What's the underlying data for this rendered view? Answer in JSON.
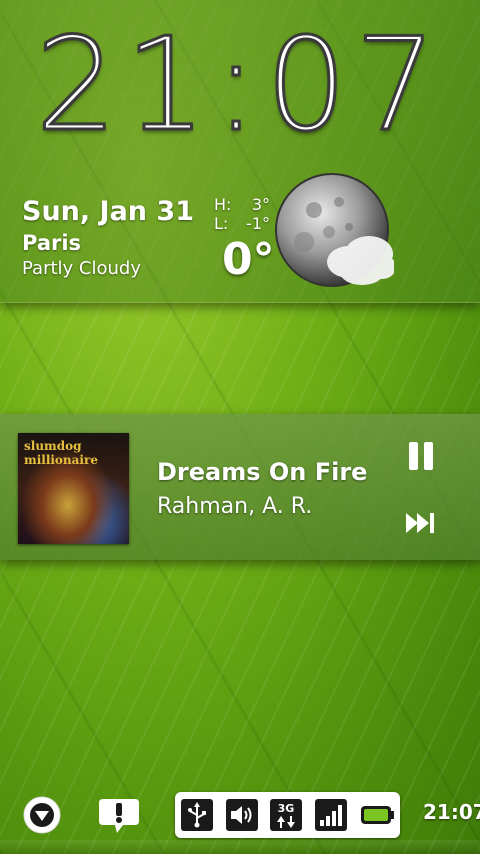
{
  "clock": {
    "time": "21:07"
  },
  "weather": {
    "date": "Sun, Jan 31",
    "city": "Paris",
    "condition": "Partly Cloudy",
    "high_label": "H:",
    "high_value": "3°",
    "low_label": "L:",
    "low_value": "-1°",
    "current_temp": "0°",
    "icon": "moon-cloud-icon"
  },
  "music": {
    "album_art_text": "slumdog millionaire",
    "song_title": "Dreams On Fire",
    "artist": "Rahman, A. R.",
    "pause_icon": "pause-icon",
    "next_icon": "skip-next-icon"
  },
  "status_bar": {
    "icons": [
      "usb-icon",
      "volume-icon",
      "3g-data-icon",
      "signal-icon",
      "battery-icon"
    ],
    "data_label": "3G",
    "time": "21:07",
    "battery_color": "#7ac521"
  },
  "colors": {
    "background": "#6fae16",
    "text": "#ffffff"
  }
}
